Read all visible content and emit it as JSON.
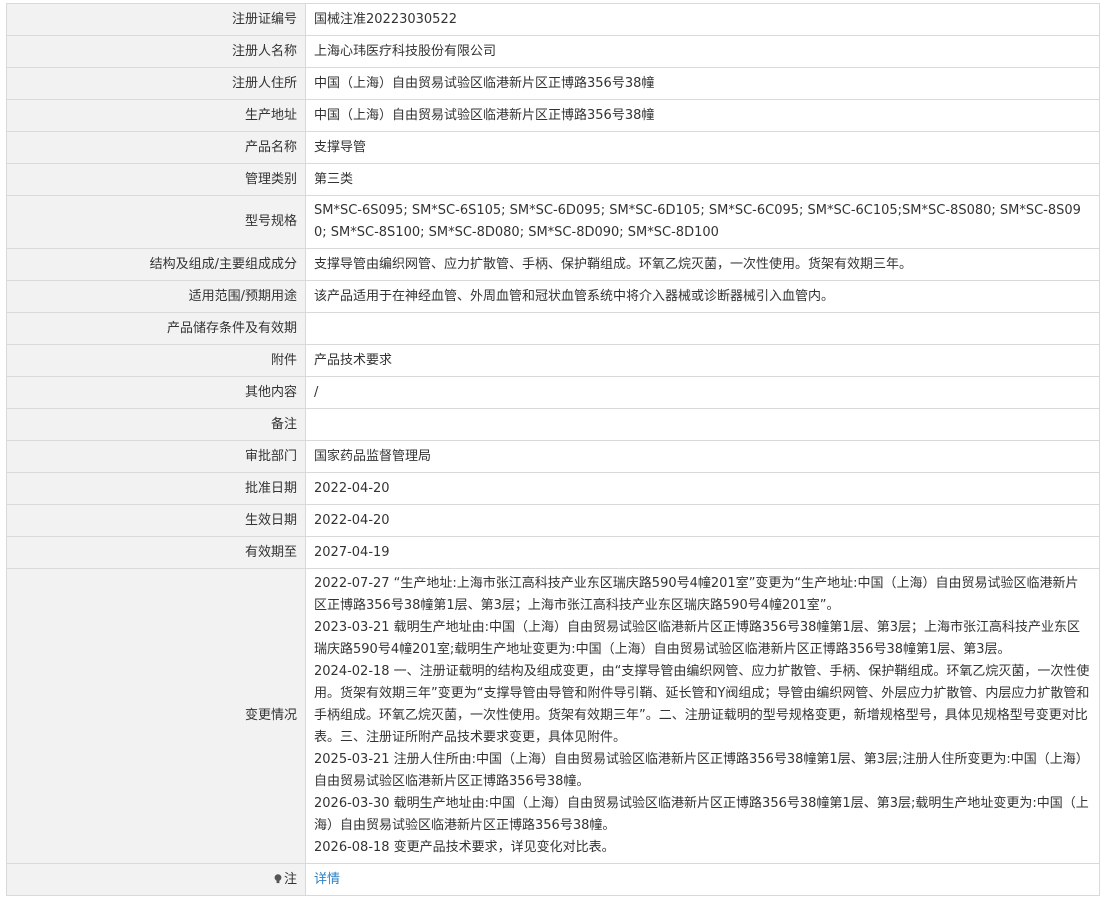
{
  "rows": [
    {
      "label": "注册证编号",
      "value": "国械注准20223030522"
    },
    {
      "label": "注册人名称",
      "value": "上海心玮医疗科技股份有限公司"
    },
    {
      "label": "注册人住所",
      "value": "中国（上海）自由贸易试验区临港新片区正博路356号38幢"
    },
    {
      "label": "生产地址",
      "value": "中国（上海）自由贸易试验区临港新片区正博路356号38幢"
    },
    {
      "label": "产品名称",
      "value": "支撑导管"
    },
    {
      "label": "管理类别",
      "value": "第三类"
    },
    {
      "label": "型号规格",
      "value": "SM*SC-6S095; SM*SC-6S105; SM*SC-6D095; SM*SC-6D105; SM*SC-6C095; SM*SC-6C105;SM*SC-8S080; SM*SC-8S090; SM*SC-8S100; SM*SC-8D080; SM*SC-8D090; SM*SC-8D100"
    },
    {
      "label": "结构及组成/主要组成成分",
      "value": "支撑导管由编织网管、应力扩散管、手柄、保护鞘组成。环氧乙烷灭菌，一次性使用。货架有效期三年。"
    },
    {
      "label": "适用范围/预期用途",
      "value": "该产品适用于在神经血管、外周血管和冠状血管系统中将介入器械或诊断器械引入血管内。"
    },
    {
      "label": "产品储存条件及有效期",
      "value": ""
    },
    {
      "label": "附件",
      "value": "产品技术要求"
    },
    {
      "label": "其他内容",
      "value": "/"
    },
    {
      "label": "备注",
      "value": ""
    },
    {
      "label": "审批部门",
      "value": "国家药品监督管理局"
    },
    {
      "label": "批准日期",
      "value": "2022-04-20"
    },
    {
      "label": "生效日期",
      "value": "2022-04-20"
    },
    {
      "label": "有效期至",
      "value": "2027-04-19"
    }
  ],
  "changes": {
    "label": "变更情况",
    "items": [
      "2022-07-27 “生产地址:上海市张江高科技产业东区瑞庆路590号4幢201室”变更为“生产地址:中国（上海）自由贸易试验区临港新片区正博路356号38幢第1层、第3层；上海市张江高科技产业东区瑞庆路590号4幢201室”。",
      "2023-03-21 载明生产地址由:中国（上海）自由贸易试验区临港新片区正博路356号38幢第1层、第3层；上海市张江高科技产业东区瑞庆路590号4幢201室;载明生产地址变更为:中国（上海）自由贸易试验区临港新片区正博路356号38幢第1层、第3层。",
      "2024-02-18 一、注册证载明的结构及组成变更，由“支撑导管由编织网管、应力扩散管、手柄、保护鞘组成。环氧乙烷灭菌，一次性使用。货架有效期三年”变更为“支撑导管由导管和附件导引鞘、延长管和Y阀组成；导管由编织网管、外层应力扩散管、内层应力扩散管和手柄组成。环氧乙烷灭菌，一次性使用。货架有效期三年”。二、注册证载明的型号规格变更，新增规格型号，具体见规格型号变更对比表。三、注册证所附产品技术要求变更，具体见附件。",
      "2025-03-21 注册人住所由:中国（上海）自由贸易试验区临港新片区正博路356号38幢第1层、第3层;注册人住所变更为:中国（上海）自由贸易试验区临港新片区正博路356号38幢。",
      "2026-03-30 载明生产地址由:中国（上海）自由贸易试验区临港新片区正博路356号38幢第1层、第3层;载明生产地址变更为:中国（上海）自由贸易试验区临港新片区正博路356号38幢。",
      "2026-08-18 变更产品技术要求，详见变化对比表。"
    ]
  },
  "note": {
    "label": "注",
    "icon": "lightbulb-icon",
    "link_text": "详情"
  }
}
